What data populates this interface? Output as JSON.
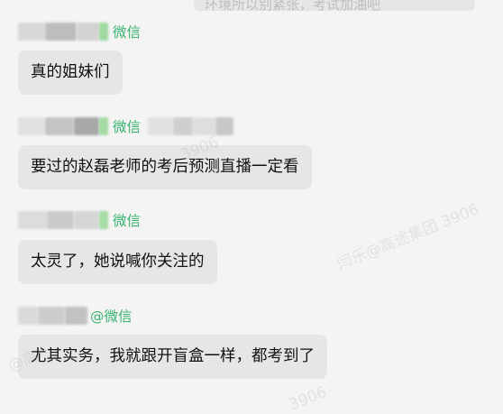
{
  "top_partial": {
    "text": "环境所以别紧张，考试加油吧"
  },
  "messages": [
    {
      "tag": "微信",
      "text": "真的姐妹们"
    },
    {
      "tag": "微信",
      "text": "要过的赵磊老师的考后预测直播一定看"
    },
    {
      "tag": "微信",
      "text": "太灵了，她说喊你关注的"
    },
    {
      "tag": "@微信",
      "text": "尤其实务，我就跟开盲盒一样，都考到了"
    }
  ],
  "watermarks": [
    "闫乐@高途集团 3906",
    "3906",
    "@高",
    "3906"
  ],
  "colors": {
    "background": "#f4f4f4",
    "bubble": "#e6e6e6",
    "wechat_green": "#3cb371"
  }
}
